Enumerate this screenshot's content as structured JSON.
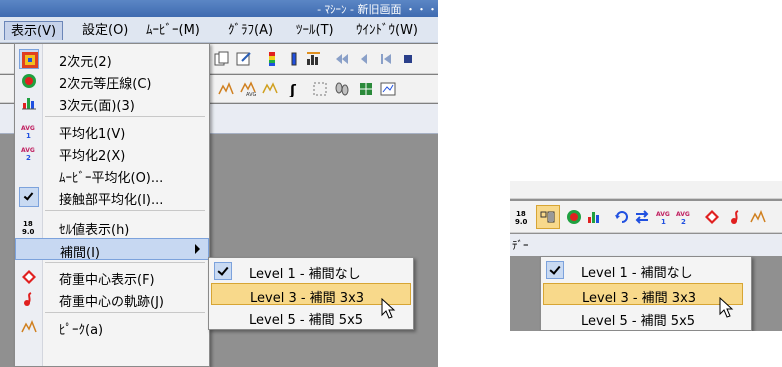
{
  "left_screenshot": {
    "title_fragment": "- ﾏｼｰﾝ - 新旧画面 ・・・",
    "menubar": [
      {
        "label": "表示(V)"
      },
      {
        "label": "設定(O)"
      },
      {
        "label": "ﾑｰﾋﾞｰ(M)"
      },
      {
        "label": "ｸﾞﾗﾌ(A)"
      },
      {
        "label": "ﾂｰﾙ(T)"
      },
      {
        "label": "ｳｲﾝﾄﾞｳ(W)"
      }
    ],
    "view_menu": {
      "items": [
        {
          "label": "2次元(2)",
          "icon": "2d-colormap-icon",
          "checked": true
        },
        {
          "label": "2次元等圧線(C)",
          "icon": "contour-icon"
        },
        {
          "label": "3次元(面)(3)",
          "icon": "3d-surface-icon"
        },
        {
          "label": "平均化1(V)",
          "icon": "avg1-icon"
        },
        {
          "label": "平均化2(X)",
          "icon": "avg2-icon"
        },
        {
          "label": "ﾑｰﾋﾞｰ平均化(O)...",
          "icon": ""
        },
        {
          "label": "接触部平均化(I)...",
          "icon": "check-icon",
          "checked": true
        },
        {
          "label": "ｾﾙ値表示(h)",
          "icon": "cell-value-icon"
        },
        {
          "label": "補間(I)",
          "icon": "",
          "submenu": true
        },
        {
          "label": "荷重中心表示(F)",
          "icon": "load-center-icon"
        },
        {
          "label": "荷重中心の軌跡(J)",
          "icon": "load-center-trail-icon"
        },
        {
          "label": "ﾋﾟｰｸ(a)",
          "icon": "peak-icon"
        }
      ]
    },
    "interpolation_submenu": [
      {
        "label": "Level 1 - 補間なし",
        "checked": true
      },
      {
        "label": "Level 3 - 補間  3x3",
        "highlighted": true
      },
      {
        "label": "Level 5 - 補間  5x5"
      }
    ],
    "cell_value_icon_text": [
      "18",
      "9.0"
    ],
    "avg_icon_text": [
      "AVG",
      "1",
      "2"
    ]
  },
  "right_screenshot": {
    "submenu": [
      {
        "label": "Level 1 - 補間なし",
        "mnemonic": "1",
        "checked": true
      },
      {
        "label": "Level 3 - 補間  3x3",
        "mnemonic": "3",
        "highlighted": true
      },
      {
        "label": "Level 5 - 補間  5x5",
        "mnemonic": "5"
      }
    ],
    "tab_fragment": "ﾃﾞｰ",
    "cell_value_icon_text": [
      "18",
      "9.0"
    ],
    "avg_icon_text": [
      "AVG",
      "1",
      "2"
    ]
  },
  "colors": {
    "menu_highlight_blue": "#c7d8f2",
    "submenu_highlight": "#f8d98b",
    "menubar_bg": "#dfe6f1"
  }
}
